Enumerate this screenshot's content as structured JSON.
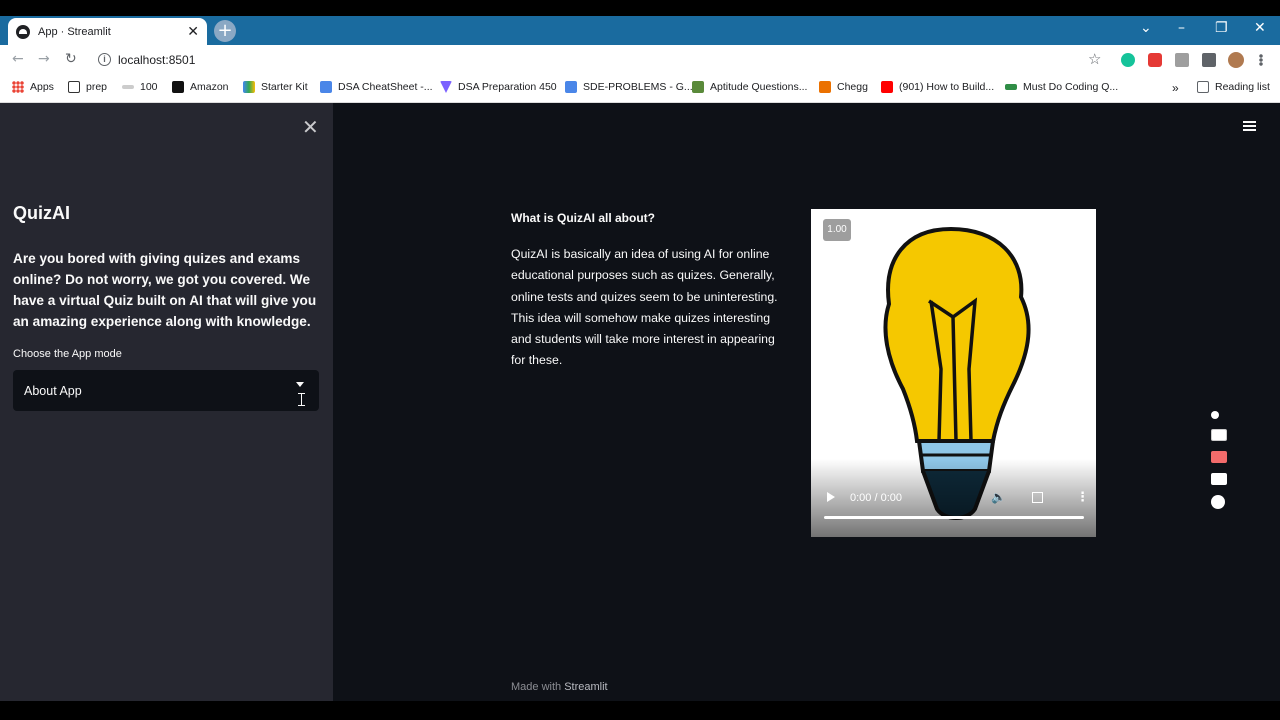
{
  "browser": {
    "tab_title": "App · Streamlit",
    "url": "localhost:8501",
    "bookmarks": [
      "Apps",
      "prep",
      "100",
      "Amazon",
      "Starter Kit",
      "DSA CheatSheet -...",
      "DSA Preparation 450",
      "SDE-PROBLEMS - G...",
      "Aptitude Questions...",
      "Chegg",
      "(901) How to Build...",
      "Must Do Coding Q..."
    ],
    "reading_list": "Reading list",
    "more_bookmarks": "»"
  },
  "sidebar": {
    "title": "QuizAI",
    "description": "Are you bored with giving quizes and exams online? Do not worry, we got you covered. We have a virtual Quiz built on AI that will give you an amazing experience along with knowledge.",
    "select_label": "Choose the App mode",
    "select_value": "About App"
  },
  "main": {
    "heading": "What is QuizAI all about?",
    "body": "QuizAI is basically an idea of using AI for online educational purposes such as quizes. Generally, online tests and quizes seem to be uninteresting. This idea will somehow make quizes interesting and students will take more interest in appearing for these.",
    "video": {
      "speed": "1.00",
      "time": "0:00 / 0:00"
    }
  },
  "footer": {
    "prefix": "Made with",
    "brand": "Streamlit"
  },
  "colors": {
    "app_bg": "#0e1117",
    "sidebar_bg": "#262730",
    "text": "#fafafa",
    "bulb": "#f5c800",
    "tabstrip": "#1a6b9f"
  },
  "icons": [
    "close-icon",
    "menu-icon",
    "play-icon",
    "volume-icon",
    "fullscreen-icon",
    "more-icon",
    "camera-icon",
    "record-icon",
    "gallery-icon",
    "settings-icon"
  ]
}
